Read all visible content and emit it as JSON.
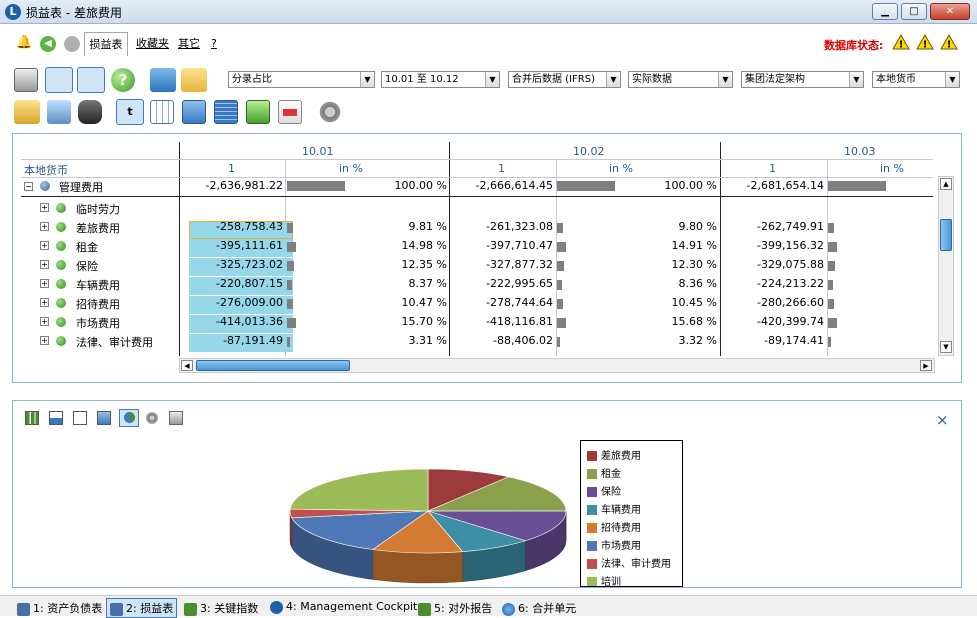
{
  "window": {
    "title": "损益表 - 差旅费用",
    "app_icon": "L",
    "min": "▁",
    "max": "□",
    "close": "✕"
  },
  "tabs": {
    "active": "损益表",
    "favorites": "收藏夹",
    "other": "其它",
    "help": "?"
  },
  "status": {
    "db_label": "数据库状态:"
  },
  "filters": {
    "view": "分录占比",
    "period": "10.01 至 10.12",
    "data_source": "合并后数据 (IFRS)",
    "type": "实际数据",
    "structure": "集团法定架构",
    "currency": "本地货币",
    "arrow": "▼"
  },
  "grid": {
    "header_label": "本地货币",
    "periods": [
      "10.01",
      "10.02",
      "10.03"
    ],
    "sub_cols": [
      "1",
      "in %"
    ],
    "parent": {
      "label": "管理费用",
      "values": [
        "-2,636,981.22",
        "-2,666,614.45",
        "-2,681,654.14"
      ],
      "pcts": [
        "100.00 %",
        "100.00 %",
        ""
      ]
    },
    "rows": [
      {
        "label": "临时劳力",
        "values": [
          "",
          "",
          ""
        ],
        "pcts": [
          "",
          "",
          ""
        ],
        "bars": [
          0,
          0,
          0
        ]
      },
      {
        "label": "差旅费用",
        "values": [
          "-258,758.43",
          "-261,323.08",
          "-262,749.91"
        ],
        "pcts": [
          "9.81 %",
          "9.80 %",
          ""
        ],
        "bars": [
          9.81,
          9.8,
          9.8
        ]
      },
      {
        "label": "租金",
        "values": [
          "-395,111.61",
          "-397,710.47",
          "-399,156.32"
        ],
        "pcts": [
          "14.98 %",
          "14.91 %",
          ""
        ],
        "bars": [
          14.98,
          14.91,
          14.9
        ]
      },
      {
        "label": "保险",
        "values": [
          "-325,723.02",
          "-327,877.32",
          "-329,075.88"
        ],
        "pcts": [
          "12.35 %",
          "12.30 %",
          ""
        ],
        "bars": [
          12.35,
          12.3,
          12.3
        ]
      },
      {
        "label": "车辆费用",
        "values": [
          "-220,807.15",
          "-222,995.65",
          "-224,213.22"
        ],
        "pcts": [
          "8.37 %",
          "8.36 %",
          ""
        ],
        "bars": [
          8.37,
          8.36,
          8.36
        ]
      },
      {
        "label": "招待费用",
        "values": [
          "-276,009.00",
          "-278,744.64",
          "-280,266.60"
        ],
        "pcts": [
          "10.47 %",
          "10.45 %",
          ""
        ],
        "bars": [
          10.47,
          10.45,
          10.45
        ]
      },
      {
        "label": "市场费用",
        "values": [
          "-414,013.36",
          "-418,116.81",
          "-420,399.74"
        ],
        "pcts": [
          "15.70 %",
          "15.68 %",
          ""
        ],
        "bars": [
          15.7,
          15.68,
          15.68
        ]
      },
      {
        "label": "法律、审计费用",
        "values": [
          "-87,191.49",
          "-88,406.02",
          "-89,174.41"
        ],
        "pcts": [
          "3.31 %",
          "3.32 %",
          ""
        ],
        "bars": [
          3.31,
          3.32,
          3.32
        ]
      }
    ]
  },
  "chart": {
    "close": "×",
    "legend": [
      {
        "label": "差旅费用",
        "color": "#9c3b3b"
      },
      {
        "label": "租金",
        "color": "#8aa04a"
      },
      {
        "label": "保险",
        "color": "#6a4f94"
      },
      {
        "label": "车辆费用",
        "color": "#3e8fa6"
      },
      {
        "label": "招待费用",
        "color": "#d37b32"
      },
      {
        "label": "市场费用",
        "color": "#4f78b8"
      },
      {
        "label": "法律、审计费用",
        "color": "#c0504d"
      },
      {
        "label": "培训",
        "color": "#9bbb59"
      }
    ]
  },
  "chart_data": {
    "type": "pie",
    "categories": [
      "差旅费用",
      "租金",
      "保险",
      "车辆费用",
      "招待费用",
      "市场费用",
      "法律、审计费用",
      "培训"
    ],
    "values": [
      9.81,
      14.98,
      12.35,
      8.37,
      10.47,
      15.7,
      3.31,
      24.01
    ]
  },
  "statusbar": {
    "items": [
      "1: 资产负债表",
      "2: 损益表",
      "3: 关键指数",
      "4: Management Cockpit",
      "5: 对外报告",
      "6: 合并单元"
    ]
  }
}
